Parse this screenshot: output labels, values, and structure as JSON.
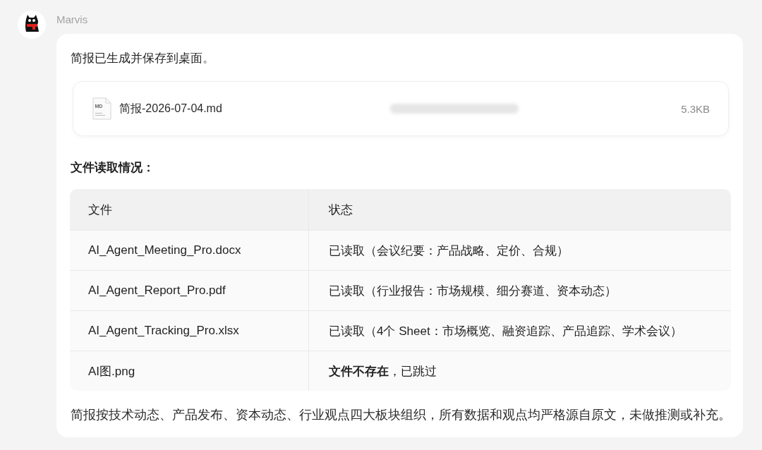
{
  "sender": {
    "name": "Marvis"
  },
  "message": {
    "intro": "简报已生成并保存到桌面。",
    "attachment": {
      "type_label": "MD",
      "name": "简报-2026-07-04.md",
      "size": "5.3KB"
    },
    "section_title": "文件读取情况：",
    "table": {
      "columns": [
        "文件",
        "状态"
      ],
      "rows": [
        {
          "cells": [
            "AI_Agent_Meeting_Pro.docx",
            "已读取（会议纪要：产品战略、定价、合规）"
          ]
        },
        {
          "cells": [
            "AI_Agent_Report_Pro.pdf",
            "已读取（行业报告：市场规模、细分赛道、资本动态）"
          ]
        },
        {
          "cells": [
            "AI_Agent_Tracking_Pro.xlsx",
            "已读取（4个 Sheet：市场概览、融资追踪、产品追踪、学术会议）"
          ]
        },
        {
          "cells": [
            "AI图.png",
            "**文件不存在**，已跳过"
          ]
        }
      ]
    },
    "summary": "简报按技术动态、产品发布、资本动态、行业观点四大板块组织，所有数据和观点均严格源自原文，未做推测或补充。"
  }
}
